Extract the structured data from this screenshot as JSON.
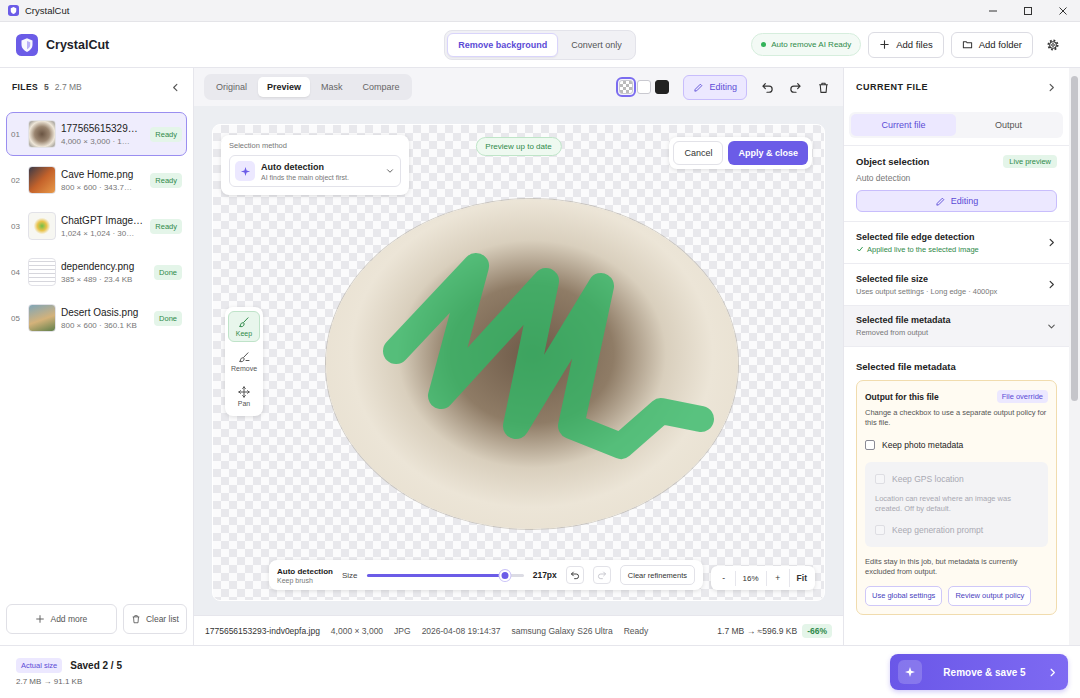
{
  "window": {
    "title": "CrystalCut"
  },
  "header": {
    "app_name": "CrystalCut",
    "modes": [
      {
        "label": "Remove background",
        "selected": true
      },
      {
        "label": "Convert only",
        "selected": false
      }
    ],
    "ai_status": {
      "label": "Auto remove AI Ready",
      "ready": true
    },
    "buttons": [
      "Add files",
      "Add folder"
    ]
  },
  "sidebar": {
    "title": "FILES",
    "count": "5",
    "size": "2.7 MB",
    "files": [
      {
        "index": "01",
        "name": "177565615329…",
        "meta": "4,000 × 3,000 · 1…",
        "status": "Ready",
        "selected": true
      },
      {
        "index": "02",
        "name": "Cave Home.png",
        "meta": "800 × 600 · 343.7…",
        "status": "Ready",
        "selected": false
      },
      {
        "index": "03",
        "name": "ChatGPT Image…",
        "meta": "1,024 × 1,024 · 30…",
        "status": "Ready",
        "selected": false
      },
      {
        "index": "04",
        "name": "dependency.png",
        "meta": "385 × 489 · 23.4 KB",
        "status": "Done",
        "selected": false
      },
      {
        "index": "05",
        "name": "Desert Oasis.png",
        "meta": "800 × 600 · 360.1 KB",
        "status": "Done",
        "selected": false
      }
    ],
    "buttons": [
      "Add more",
      "Clear list"
    ]
  },
  "viewer": {
    "tabs": [
      {
        "label": "Original",
        "selected": false
      },
      {
        "label": "Preview",
        "selected": true
      },
      {
        "label": "Mask",
        "selected": false
      },
      {
        "label": "Compare",
        "selected": false
      }
    ],
    "backgrounds": [
      {
        "kind": "checker",
        "selected": true
      },
      {
        "kind": "white",
        "selected": false
      },
      {
        "kind": "black",
        "selected": false
      }
    ],
    "editing": {
      "label": "Editing",
      "selected": true
    },
    "selection_method": {
      "title": "Selection method",
      "value": "Auto detection",
      "hint": "AI finds the main object first."
    },
    "preview_status": "Preview up to date",
    "actions": [
      "Cancel",
      "Apply & close"
    ],
    "tools": [
      {
        "label": "Keep",
        "selected": true
      },
      {
        "label": "Remove",
        "selected": false
      },
      {
        "label": "Pan",
        "selected": false
      }
    ],
    "brush_bar": {
      "mode": "Auto detection",
      "brush": "Keep brush",
      "size_label": "Size",
      "level": 0.88,
      "reading": "217px",
      "undo_disabled": false,
      "redo_disabled": true,
      "clear": "Clear refinements"
    },
    "zoom": {
      "minus": "-",
      "value": "16%",
      "plus": "+",
      "fit": "Fit"
    }
  },
  "status_bar": {
    "items": [
      "1775656153293-indv0epfa.jpg",
      "4,000 × 3,000",
      "JPG",
      "2026-04-08 19:14:37",
      "samsung Galaxy S26 Ultra",
      "Ready"
    ],
    "size": "1.7 MB → ≈596.9 KB",
    "saving": "-66%"
  },
  "right_panel": {
    "title": "CURRENT FILE",
    "tabs": [
      {
        "label": "Current file",
        "selected": true
      },
      {
        "label": "Output",
        "selected": false
      }
    ],
    "object_selection": {
      "title": "Object selection",
      "badge": "Live preview",
      "method": "Auto detection",
      "button": "Editing"
    },
    "rows": [
      {
        "title": "Selected file edge detection",
        "detail": "Applied live to the selected image",
        "ok": true,
        "expanded": false
      },
      {
        "title": "Selected file size",
        "detail": "Uses output settings · Long edge · 4000px",
        "ok": false,
        "expanded": false
      },
      {
        "title": "Selected file metadata",
        "detail": "Removed from output",
        "ok": false,
        "expanded": true
      }
    ],
    "metadata": {
      "heading": "Selected file metadata",
      "title": "Output for this file",
      "badge": "File override",
      "description": "Change a checkbox to use a separate output policy for this file.",
      "option": {
        "label": "Keep photo metadata",
        "checked": false,
        "disabled": false
      },
      "sub_options": [
        {
          "kind": "checkbox",
          "label": "Keep GPS location",
          "checked": false,
          "disabled": true
        },
        {
          "kind": "note",
          "label": "Location can reveal where an image was created. Off by default."
        },
        {
          "kind": "checkbox",
          "label": "Keep generation prompt",
          "checked": false,
          "disabled": true
        }
      ],
      "note": "Edits stay in this job, but metadata is currently excluded from output.",
      "buttons": [
        "Use global settings",
        "Review output policy"
      ]
    },
    "scrollbar": {
      "level": 0.58
    }
  },
  "bottom_bar": {
    "size_badge": "Actual size",
    "saved": "Saved 2 / 5",
    "sizes": "2.7 MB → 91.1 KB",
    "button": "Remove & save 5"
  }
}
